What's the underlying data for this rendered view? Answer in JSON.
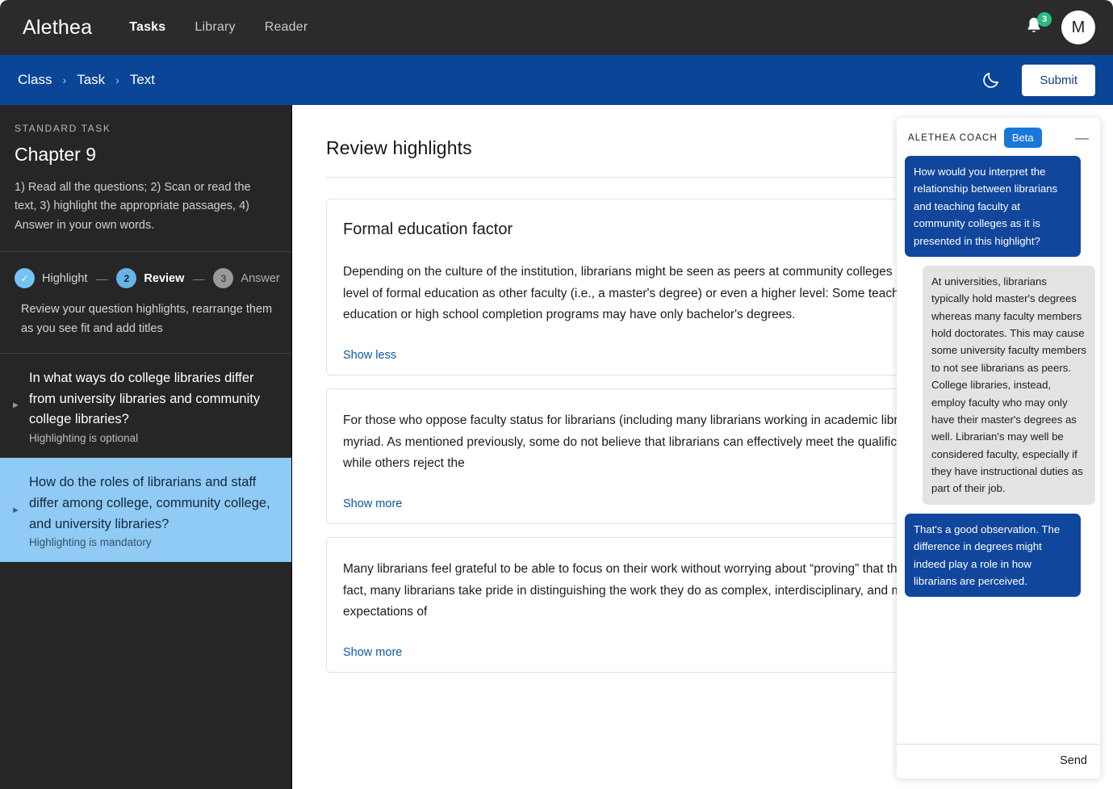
{
  "topnav": {
    "brand": "Alethea",
    "links": [
      {
        "label": "Tasks",
        "active": true
      },
      {
        "label": "Library",
        "active": false
      },
      {
        "label": "Reader",
        "active": false
      }
    ],
    "notification_count": "3",
    "avatar_initial": "M"
  },
  "breadcrumb": {
    "items": [
      "Class",
      "Task",
      "Text"
    ],
    "separator": "›",
    "submit_label": "Submit",
    "dark_mode_icon": "moon-icon",
    "bar_color": "#0a4597"
  },
  "sidebar": {
    "kicker": "STANDARD TASK",
    "title": "Chapter 9",
    "description": "1) Read all the questions; 2) Scan or read the text, 3) highlight the appropriate passages, 4) Answer in your own words.",
    "steps": [
      {
        "marker": "✓",
        "label": "Highlight",
        "state": "done"
      },
      {
        "marker": "2",
        "label": "Review",
        "state": "current"
      },
      {
        "marker": "3",
        "label": "Answer",
        "state": "future"
      }
    ],
    "step_separator": "—",
    "steps_help": "Review your question highlights, rearrange them as you see fit and add titles",
    "questions": [
      {
        "title": "In what ways do college libraries differ from university libraries and community college libraries?",
        "subtitle": "Highlighting is optional",
        "selected": false
      },
      {
        "title": "How do the roles of librarians and staff differ among college, community college, and university libraries?",
        "subtitle": "Highlighting is mandatory",
        "selected": true
      }
    ]
  },
  "main": {
    "title": "Review highlights",
    "cards": [
      {
        "title": "Formal education factor",
        "body": "Depending on the culture of the institution, librarians might be seen as peers at community colleges because they have the same level of formal education as other faculty (i.e., a master's degree) or even a higher level: Some teaching faculty in adult basic education or high school completion programs may have only bachelor's degrees.",
        "toggle": "Show less"
      },
      {
        "title": "",
        "body": "For those who oppose faculty status for librarians (including many librarians working in academic libraries), the reasons are myriad. As mentioned previously, some do not believe that librarians can effectively meet the qualifications of tenured faculty, while others reject the",
        "toggle": "Show more"
      },
      {
        "title": "",
        "body": "Many librarians feel grateful to be able to focus on their work without worrying about “proving” that they are the same as faculty; in fact, many librarians take pride in distinguishing the work they do as complex, interdisciplinary, and multifaceted—in con- trast to expectations of",
        "toggle": "Show more"
      }
    ],
    "card_action_icons": [
      "edit-pencil-icon",
      "eye-icon",
      "trash-icon"
    ]
  },
  "chat": {
    "header_title": "ALETHEA COACH",
    "beta_label": "Beta",
    "minimize_label": "—",
    "messages": [
      {
        "role": "user",
        "text": "How would you interpret the relationship between librarians and teaching faculty at community colleges as it is presented in this highlight?"
      },
      {
        "role": "bot",
        "text": "At universities, librarians typically hold master's degrees whereas many faculty members hold doctorates. This may cause some university faculty members to not see librarians as peers. College libraries, instead, employ faculty who may only have their master's degrees as well. Librarian's may well be considered faculty, especially if they have instructional duties as part of their job."
      },
      {
        "role": "user",
        "text": "That's a good observation. The difference in degrees might indeed play a role in how librarians are perceived."
      }
    ],
    "send_label": "Send"
  },
  "colors": {
    "nav_bg": "#2b2b2b",
    "breadcrumb_bg": "#0a4597",
    "sidebar_bg": "#262626",
    "selected_question_bg": "#8fcbf5",
    "accent_blue": "#0b57a4",
    "badge_green": "#2bbd7e",
    "beta_blue": "#1877d9",
    "user_bubble": "#10469c",
    "bot_bubble": "#e3e3e3"
  }
}
